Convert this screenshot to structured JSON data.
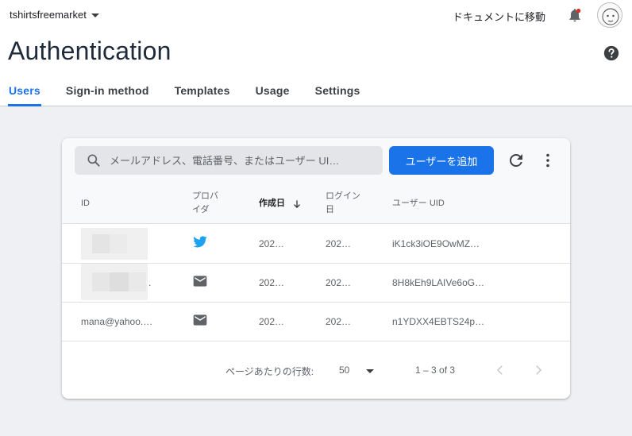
{
  "header": {
    "project_name": "tshirtsfreemarket",
    "docs_link": "ドキュメントに移動",
    "title": "Authentication"
  },
  "tabs": [
    {
      "label": "Users",
      "active": true
    },
    {
      "label": "Sign-in method",
      "active": false
    },
    {
      "label": "Templates",
      "active": false
    },
    {
      "label": "Usage",
      "active": false
    },
    {
      "label": "Settings",
      "active": false
    }
  ],
  "toolbar": {
    "search_placeholder": "メールアドレス、電話番号、またはユーザー UI…",
    "add_user_label": "ユーザーを追加"
  },
  "table": {
    "columns": [
      "ID",
      "プロバイダ",
      "作成日",
      "ログイン日",
      "ユーザー UID"
    ],
    "rows": [
      {
        "id": "",
        "provider": "twitter-icon",
        "created": "202…",
        "signed_in": "202…",
        "uid": "iK1ck3iOE9OwMZ…"
      },
      {
        "id": ".",
        "provider": "email-icon",
        "created": "202…",
        "signed_in": "202…",
        "uid": "8H8kEh9LAIVe6oG…"
      },
      {
        "id": "mana@yahoo.…",
        "provider": "email-icon",
        "created": "202…",
        "signed_in": "202…",
        "uid": "n1YDXX4EBTS24p…"
      }
    ]
  },
  "pagination": {
    "rows_per_page_label": "ページあたりの行数:",
    "rows_per_page_value": "50",
    "range": "1 – 3 of 3"
  },
  "colors": {
    "accent": "#1a73e8",
    "twitter": "#1da1f2",
    "notification_dot": "#d93025"
  }
}
